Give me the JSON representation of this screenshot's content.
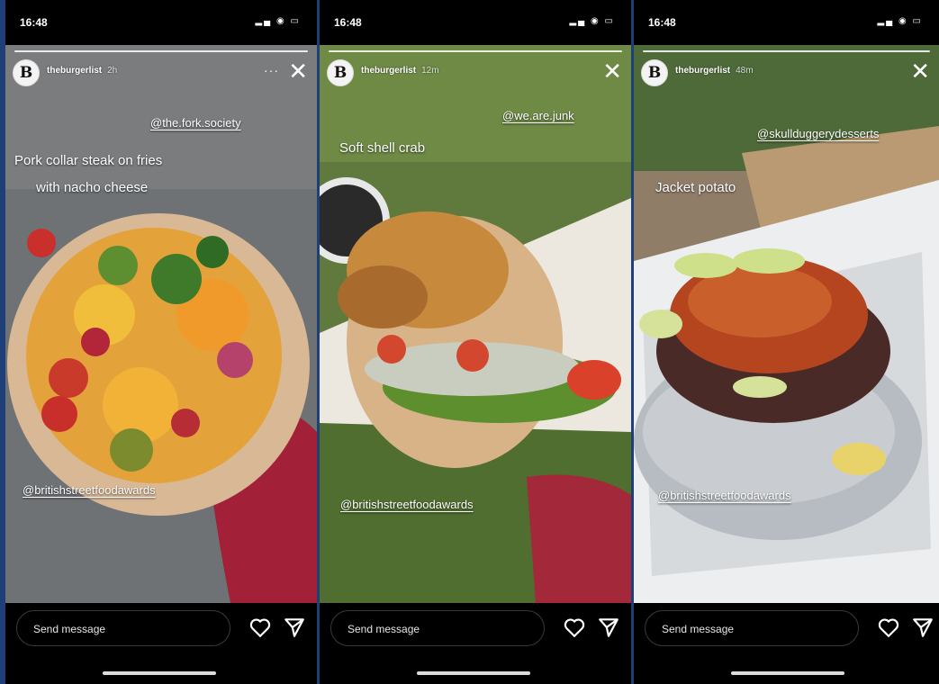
{
  "stories": [
    {
      "time": "16:48",
      "username": "theburgerlist",
      "age": "2h",
      "more": "···",
      "caption_lines": [
        "Pork collar steak on fries",
        "with nacho cheese"
      ],
      "mention_top": "@the.fork.society",
      "mention_bottom": "@britishstreetfoodawards",
      "message_placeholder": "Send message",
      "background": "#6b6e70"
    },
    {
      "time": "16:48",
      "username": "theburgerlist",
      "age": "12m",
      "more": "",
      "caption_lines": [
        "Soft shell crab"
      ],
      "mention_top": "@we.are.junk",
      "mention_bottom": "@britishstreetfoodawards",
      "message_placeholder": "Send message",
      "background": "#566e3a"
    },
    {
      "time": "16:48",
      "username": "theburgerlist",
      "age": "48m",
      "more": "",
      "caption_lines": [
        "Jacket potato"
      ],
      "mention_top": "@skullduggerydesserts",
      "mention_bottom": "@britishstreetfoodawards",
      "message_placeholder": "Send message",
      "background": "#8a7a66"
    }
  ],
  "icons": {
    "avatar_letter": "B",
    "close": "✕",
    "heart": "heart-icon",
    "send": "paper-plane-icon"
  }
}
